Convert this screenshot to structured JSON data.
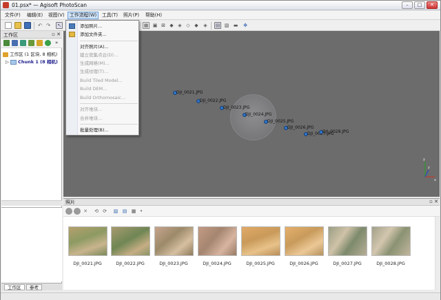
{
  "window": {
    "title": "01.psx* — Agisoft PhotoScan",
    "minimize": "–",
    "maximize": "□",
    "close": "✕"
  },
  "menu": [
    {
      "label": "文件(F)"
    },
    {
      "label": "编辑(E)"
    },
    {
      "label": "视图(V)"
    },
    {
      "label": "工作流程(W)"
    },
    {
      "label": "工具(T)"
    },
    {
      "label": "照片(P)"
    },
    {
      "label": "帮助(H)"
    }
  ],
  "workflow_menu": {
    "items": [
      {
        "label": "添加照片...",
        "enabled": true,
        "icon": "add-photos-icon"
      },
      {
        "label": "添加文件夹...",
        "enabled": true,
        "icon": "add-folder-icon"
      },
      {
        "label": "对齐照片(A)...",
        "enabled": true
      },
      {
        "label": "建立密集点云(D)...",
        "enabled": false
      },
      {
        "label": "生成网格(M)...",
        "enabled": false
      },
      {
        "label": "生成纹理(T)...",
        "enabled": false
      },
      {
        "label": "Build Tiled Model...",
        "enabled": false
      },
      {
        "label": "Build DEM...",
        "enabled": false
      },
      {
        "label": "Build Orthomosaic...",
        "enabled": false
      },
      {
        "label": "对齐堆块...",
        "enabled": false
      },
      {
        "label": "合并堆块...",
        "enabled": false
      },
      {
        "label": "批量处理(B)...",
        "enabled": true
      }
    ]
  },
  "workspace": {
    "title": "工作区",
    "float": "▫",
    "close": "✕",
    "root": "工作区 (1 区块, 8 相机)",
    "chunk": "Chunk 1 (8 相机)",
    "expand_arrow": "▷",
    "tabs": [
      {
        "label": "工作区"
      },
      {
        "label": "参考"
      }
    ]
  },
  "viewport": {
    "cameras": [
      {
        "label": "DJI_0021.JPG"
      },
      {
        "label": "DJI_0022.JPG"
      },
      {
        "label": "DJI_0023.JPG"
      },
      {
        "label": "DJI_0024.JPG"
      },
      {
        "label": "DJI_0025.JPG"
      },
      {
        "label": "DJI_0026.JPG"
      },
      {
        "label": "DJI_0027.JPG"
      },
      {
        "label": "DJI_0028.JPG"
      }
    ],
    "axis_labels": {
      "z": "z",
      "y": "y",
      "x": "x"
    }
  },
  "photos": {
    "title": "照片",
    "float": "▫",
    "close": "✕",
    "items": [
      {
        "label": "DJI_0021.JPG"
      },
      {
        "label": "DJI_0022.JPG"
      },
      {
        "label": "DJI_0023.JPG"
      },
      {
        "label": "DJI_0024.JPG"
      },
      {
        "label": "DJI_0025.JPG"
      },
      {
        "label": "DJI_0026.JPG"
      },
      {
        "label": "DJI_0027.JPG"
      },
      {
        "label": "DJI_0028.JPG"
      }
    ]
  },
  "colors": {
    "camera_point": "#2f74c9",
    "viewport_bg": "#6c6c6c",
    "menu_active": "#cfe3f8"
  }
}
